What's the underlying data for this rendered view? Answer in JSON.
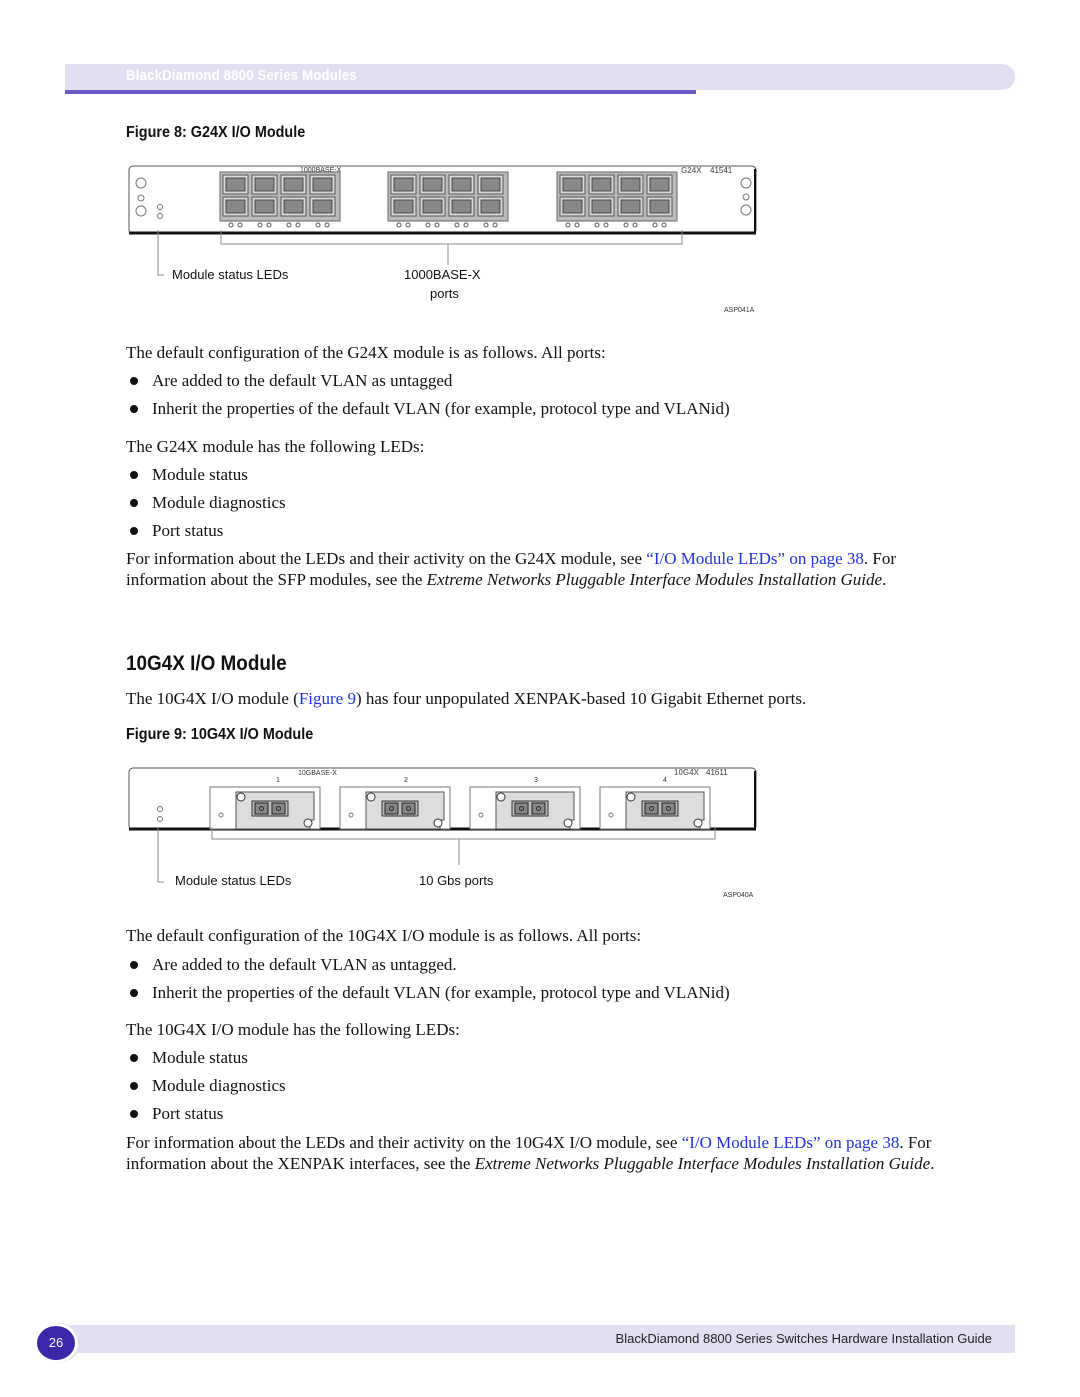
{
  "header": {
    "title": "BlackDiamond 8800 Series Modules"
  },
  "figure8": {
    "caption": "Figure 8:  G24X I/O Module",
    "panel_label": "1000BASE-X",
    "model": "G24X",
    "part_number": "41541",
    "callout_status": "Module status LEDs",
    "callout_ports_line1": "1000BASE-X",
    "callout_ports_line2": "ports",
    "code": "ASP041A"
  },
  "g24x": {
    "intro": "The default configuration of the G24X module is as follows. All ports:",
    "bullets": [
      "Are added to the default VLAN as untagged",
      "Inherit the properties of the default VLAN (for example, protocol type and VLANid)"
    ],
    "leds_intro": "The G24X module has the following LEDs:",
    "leds": [
      "Module status",
      "Module diagnostics",
      "Port status"
    ],
    "info_a": "For information about the LEDs and their activity on the G24X module, see ",
    "info_link": "“I/O Module LEDs” on page 38",
    "info_b": ". For information about the SFP modules, see the ",
    "info_italic": "Extreme Networks Pluggable Interface Modules Installation Guide",
    "info_end": "."
  },
  "section_10g4x": {
    "heading": "10G4X I/O Module",
    "intro_a": "The 10G4X I/O module (",
    "intro_link": "Figure 9",
    "intro_b": ") has four unpopulated XENPAK-based 10 Gigabit Ethernet ports."
  },
  "figure9": {
    "caption": "Figure 9:  10G4X I/O Module",
    "panel_label": "10GBASE-X",
    "model": "10G4X",
    "part_number": "41611",
    "port_numbers": [
      "1",
      "2",
      "3",
      "4"
    ],
    "callout_status": "Module status LEDs",
    "callout_ports": "10 Gbs ports",
    "code": "ASP040A"
  },
  "g10": {
    "intro": "The default configuration of the 10G4X I/O module is as follows. All ports:",
    "bullets": [
      "Are added to the default VLAN as untagged.",
      "Inherit the properties of the default VLAN (for example, protocol type and VLANid)"
    ],
    "leds_intro": "The 10G4X I/O module has the following LEDs:",
    "leds": [
      "Module status",
      "Module diagnostics",
      "Port status"
    ],
    "info_a": "For information about the LEDs and their activity on the 10G4X I/O module, see ",
    "info_link": "“I/O Module LEDs” on page 38",
    "info_b": ". For information about the XENPAK interfaces, see the ",
    "info_italic": "Extreme Networks Pluggable Interface Modules Installation Guide",
    "info_end": "."
  },
  "footer": {
    "page_number": "26",
    "title": "BlackDiamond 8800 Series Switches Hardware Installation Guide"
  }
}
